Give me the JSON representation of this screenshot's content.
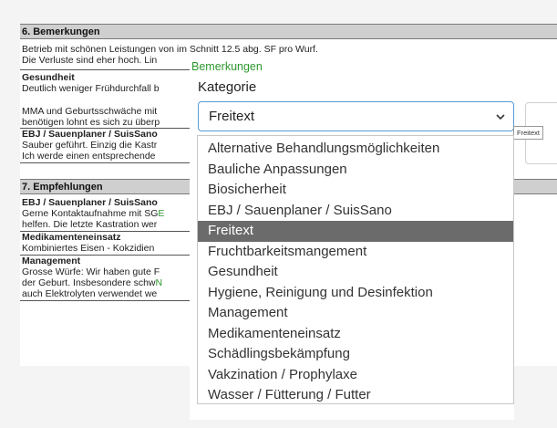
{
  "document": {
    "section6": {
      "title": "6. Bemerkungen",
      "intro1": "Betrieb mit schönen Leistungen von im Schnitt 12.5 abg. SF pro Wurf.",
      "intro2": "Die Verluste sind eher hoch. Lin",
      "gesundheit_head": "Gesundheit",
      "gesundheit_1": "Deutlich weniger Frühdurchfall b",
      "gesundheit_2": "MMA und Geburtsschwäche mit",
      "gesundheit_3": "benötigen lohnt es sich zu überp",
      "ebj_head": "EBJ / Sauenplaner / SuisSano",
      "ebj_1": "Sauber geführt. Einzig die Kastr",
      "ebj_2": "Ich werde einen entsprechende"
    },
    "section7": {
      "title": "7. Empfehlungen",
      "ebj_head": "EBJ / Sauenplaner / SuisSano",
      "ebj_1": "Gerne Kontaktaufnahme mit SG",
      "ebj_1_green": "E",
      "ebj_2": "helfen. Die letzte Kastration wer",
      "med_head": "Medikamenteneinsatz",
      "med_1": "Kombiniertes Eisen - Kokzidien",
      "man_head": "Management",
      "man_1": "Grosse Würfe: Wir haben gute F",
      "man_2": "der Geburt. Insbesondere schw",
      "man_2_green": "N",
      "man_3": "auch Elektrolyten verwendet we"
    }
  },
  "popup": {
    "title": "Bemerkungen",
    "kategorie_label": "Kategorie",
    "selected_value": "Freitext",
    "tooltip": "Freitext",
    "options": [
      "Alternative Behandlungsmöglichkeiten",
      "Bauliche Anpassungen",
      "Biosicherheit",
      "EBJ / Sauenplaner / SuisSano",
      "Freitext",
      "Fruchtbarkeitsmangement",
      "Gesundheit",
      "Hygiene, Reinigung und Desinfektion",
      "Management",
      "Medikamenteneinsatz",
      "Schädlingsbekämpfung",
      "Vakzination / Prophylaxe",
      "Wasser / Fütterung / Futter"
    ],
    "selected_index": 4
  },
  "colors": {
    "accent_green": "#2e9a2e",
    "focus_blue": "#5b9bd5",
    "selected_bg": "#6b6b6b",
    "header_bg": "#cfcfcf"
  }
}
